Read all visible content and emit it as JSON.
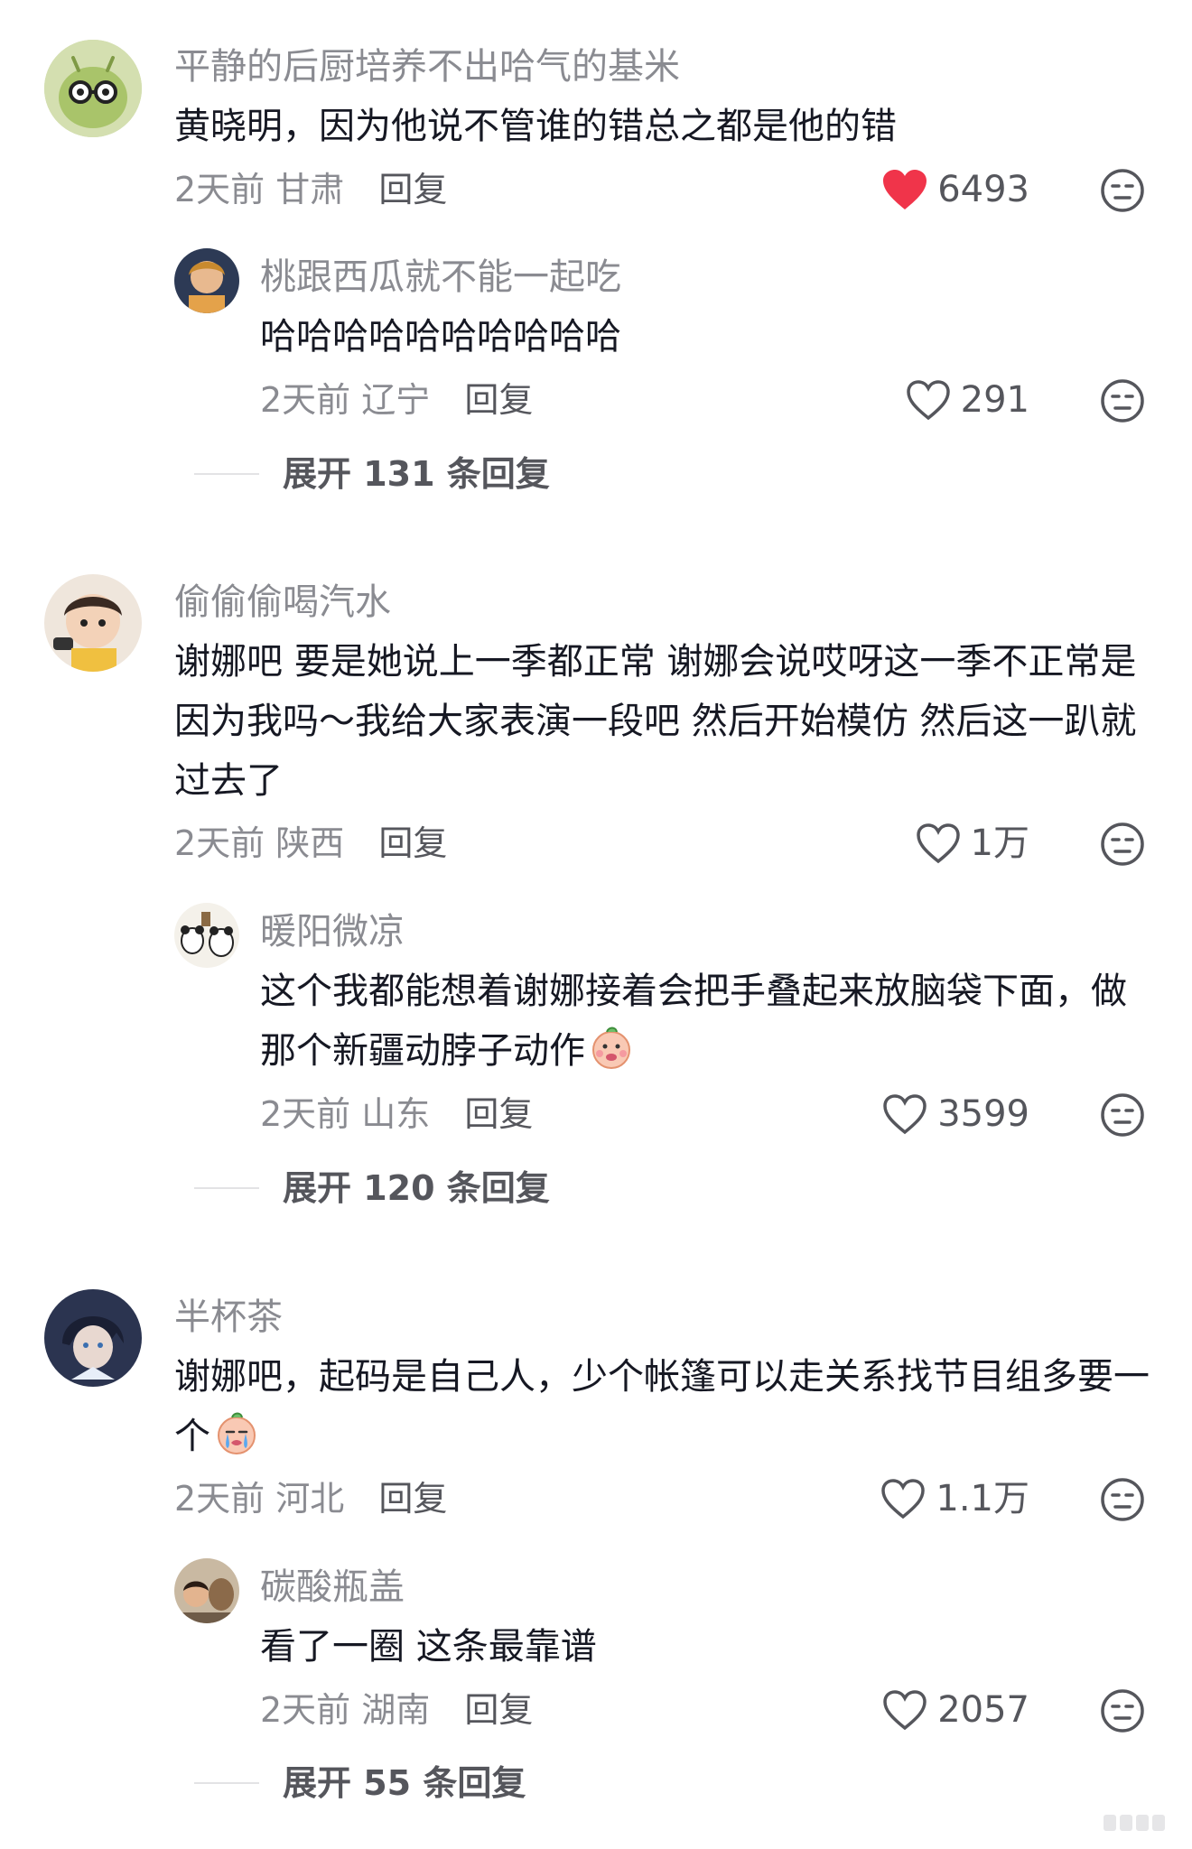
{
  "comments": [
    {
      "username": "平静的后厨培养不出哈气的基米",
      "text": "黄晓明，因为他说不管谁的错总之都是他的错",
      "time": "2天前",
      "location": "甘肃",
      "reply_label": "回复",
      "likes": "6493",
      "liked": true,
      "avatar_icon": "green-character-with-glasses-avatar",
      "replies": [
        {
          "username": "桃跟西瓜就不能一起吃",
          "text": "哈哈哈哈哈哈哈哈哈哈",
          "time": "2天前",
          "location": "辽宁",
          "reply_label": "回复",
          "likes": "291",
          "avatar_icon": "girl-photo-avatar"
        }
      ],
      "expand_label": "展开 131 条回复"
    },
    {
      "username": "偷偷偷喝汽水",
      "text": "谢娜吧  要是她说上一季都正常 谢娜会说哎呀这一季不正常是因为我吗～我给大家表演一段吧 然后开始模仿 然后这一趴就过去了",
      "time": "2天前",
      "location": "陕西",
      "reply_label": "回复",
      "likes": "1万",
      "liked": false,
      "avatar_icon": "child-photo-avatar",
      "replies": [
        {
          "username": "暖阳微凉",
          "text": "这个我都能想着谢娜接着会把手叠起来放脑袋下面，做那个新疆动脖子动作",
          "emoji": "smirk-emoji",
          "time": "2天前",
          "location": "山东",
          "reply_label": "回复",
          "likes": "3599",
          "avatar_icon": "panda-photo-avatar"
        }
      ],
      "expand_label": "展开 120 条回复"
    },
    {
      "username": "半杯茶",
      "text": "谢娜吧，起码是自己人，少个帐篷可以走关系找节目组多要一个",
      "emoji": "crying-emoji",
      "time": "2天前",
      "location": "河北",
      "reply_label": "回复",
      "likes": "1.1万",
      "liked": false,
      "avatar_icon": "anime-character-avatar",
      "replies": [
        {
          "username": "碳酸瓶盖",
          "text": "看了一圈 这条最靠谱",
          "time": "2天前",
          "location": "湖南",
          "reply_label": "回复",
          "likes": "2057",
          "avatar_icon": "movie-still-avatar"
        }
      ],
      "expand_label": "展开 55 条回复"
    }
  ],
  "colors": {
    "liked_heart": "#f0344a",
    "muted_text": "#8a8b91",
    "primary_text": "#161823",
    "action_text": "#55565c"
  }
}
